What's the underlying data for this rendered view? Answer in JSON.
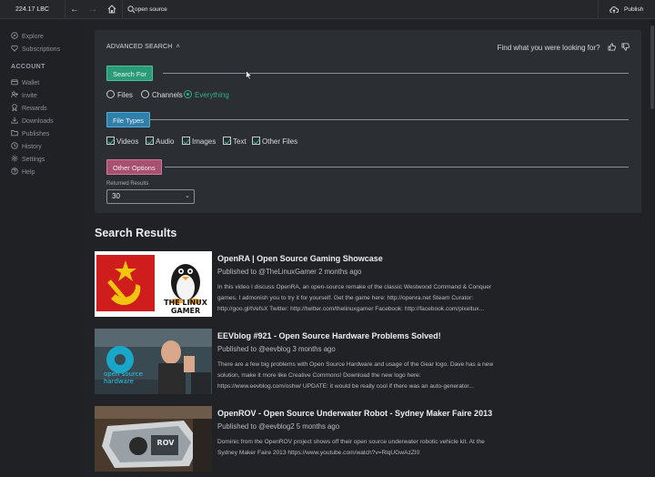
{
  "topbar": {
    "credits": "224.17 LBC",
    "search_value": "open source",
    "publish_label": "Publish"
  },
  "sidebar": {
    "items_top": [
      {
        "label": "Explore",
        "icon": "compass-icon"
      },
      {
        "label": "Subscriptions",
        "icon": "heart-icon"
      }
    ],
    "account_heading": "ACCOUNT",
    "items_account": [
      {
        "label": "Wallet",
        "icon": "wallet-icon"
      },
      {
        "label": "Invite",
        "icon": "user-plus-icon"
      },
      {
        "label": "Rewards",
        "icon": "award-icon"
      },
      {
        "label": "Downloads",
        "icon": "download-icon"
      },
      {
        "label": "Publishes",
        "icon": "folder-icon"
      },
      {
        "label": "History",
        "icon": "clock-icon"
      },
      {
        "label": "Settings",
        "icon": "gear-icon"
      },
      {
        "label": "Help",
        "icon": "help-icon"
      }
    ]
  },
  "advanced": {
    "title": "ADVANCED SEARCH",
    "feedback": "Find what you were looking for?",
    "search_for_label": "Search For",
    "search_for_options": [
      "Files",
      "Channels",
      "Everything"
    ],
    "search_for_selected": "Everything",
    "file_types_label": "File Types",
    "file_types": [
      "Videos",
      "Audio",
      "Images",
      "Text",
      "Other Files"
    ],
    "other_options_label": "Other Options",
    "returned_results_label": "Returned Results",
    "returned_results_value": "30"
  },
  "results": {
    "heading": "Search Results",
    "items": [
      {
        "title": "OpenRA | Open Source Gaming Showcase",
        "meta": "Published to @TheLinuxGamer 2 months ago",
        "desc_1": "In this video I discuss OpenRA, an open-source remake of the classic Westwood Command & Conquer",
        "desc_2": "games. I admonish you to try it for yourself. Get the game here: http://openra.net Steam Curator:",
        "desc_3": "http://goo.gl/tVefsX Twitter: http://twitter.com/thelinuxgamer Facebook: http://facebook.com/pixeltux...",
        "thumb_text": "THE LINUX GAMER"
      },
      {
        "title": "EEVblog #921 - Open Source Hardware Problems Solved!",
        "meta": "Published to @eevblog 3 months ago",
        "desc_1": "There are a few big problems with Open Source Hardware and usage of the Gear logo. Dave has a new",
        "desc_2": "solution, make it more like Creative Commons! Download the new logo here:",
        "desc_3": "https://www.eevblog.com/oshw/ UPDATE: it would be really cool if there was an auto-generator...",
        "thumb_text": "open source hardware"
      },
      {
        "title": "OpenROV - Open Source Underwater Robot - Sydney Maker Faire 2013",
        "meta": "Published to @eevblog2 5 months ago",
        "desc_1": "Dominic from the OpenROV project shows off their open source underwater robotic vehicle kit. At the",
        "desc_2": "Sydney Maker Faire 2013 https://www.youtube.com/watch?v=RlqUGwAzZI0",
        "desc_3": "",
        "thumb_text": "ROV"
      }
    ]
  }
}
